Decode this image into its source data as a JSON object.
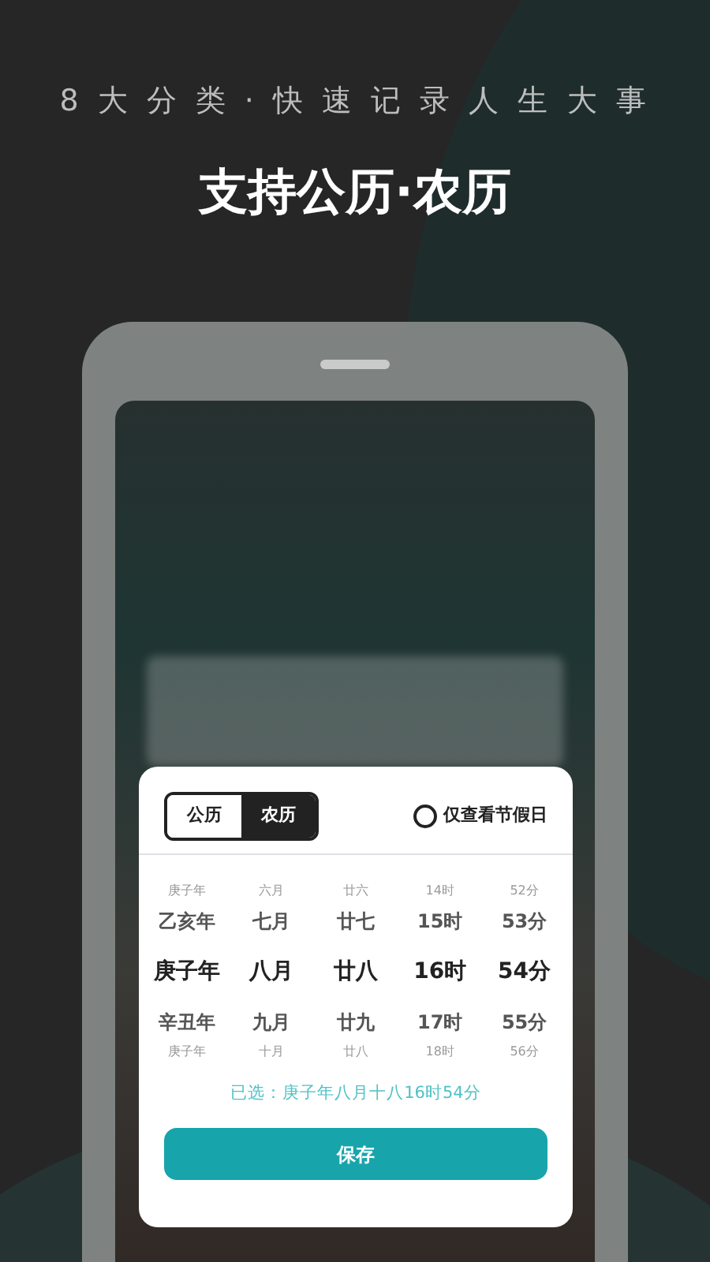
{
  "banner": {
    "subtitle": "8 大 分 类 · 快 速 记 录 人 生 大 事",
    "title": "支持公历·农历"
  },
  "picker": {
    "tabs": [
      {
        "label": "公历",
        "selected": false
      },
      {
        "label": "农历",
        "selected": true
      }
    ],
    "holiday_filter": {
      "label": "仅查看节假日",
      "checked": false
    },
    "rows": [
      {
        "kind": "far",
        "cells": [
          "庚子年",
          "六月",
          "廿六",
          "14时",
          "52分"
        ]
      },
      {
        "kind": "near",
        "cells": [
          "乙亥年",
          "七月",
          "廿七",
          "15时",
          "53分"
        ]
      },
      {
        "kind": "center",
        "cells": [
          "庚子年",
          "八月",
          "廿八",
          "16时",
          "54分"
        ]
      },
      {
        "kind": "near",
        "cells": [
          "辛丑年",
          "九月",
          "廿九",
          "17时",
          "55分"
        ]
      },
      {
        "kind": "far",
        "cells": [
          "庚子年",
          "十月",
          "廿八",
          "18时",
          "56分"
        ]
      }
    ],
    "selection": "已选：庚子年八月十八16时54分",
    "save_button": "保存"
  }
}
